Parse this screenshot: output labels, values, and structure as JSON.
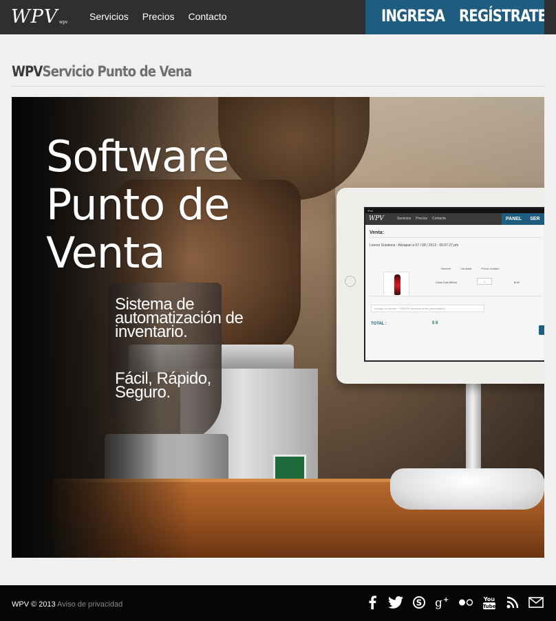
{
  "header": {
    "logo": "WPV",
    "logo_small": "wpv",
    "nav": [
      "Servicios",
      "Precios",
      "Contacto"
    ],
    "login": "INGRESA",
    "register": "REGÍSTRATE"
  },
  "page": {
    "brand": "WPV",
    "title": "Servicio Punto de Vena"
  },
  "hero": {
    "title": "Software Punto de Venta",
    "subtitle": "Sistema de automatización de inventario.",
    "tagline": "Fácil, Rápido, Seguro.",
    "screen": {
      "status": "iPad",
      "logo": "WPV",
      "nav": [
        "Servicios",
        "Precios",
        "Contacto"
      ],
      "panel": "PANEL",
      "panel_next": "SER",
      "heading": "Venta:",
      "meta": "Lemon Solutions - Atizapan a 07 / 08 / 2013 - 05:07:27 pm",
      "columns": [
        "Nombre",
        "Cantidad",
        "Precio Unitario"
      ],
      "item_name": "Coca Cola 600ml",
      "item_qty": "1",
      "item_price": "$ 00",
      "input_placeholder": "<código de barras> + ENTER presione enter para añadirlo",
      "total_label": "TOTAL :",
      "total_value": "$ 8"
    }
  },
  "footer": {
    "copyright": "WPV © 2013",
    "privacy": "Aviso de privacidad",
    "social_icons": [
      "facebook-icon",
      "twitter-icon",
      "skype-icon",
      "google-plus-icon",
      "flickr-icon",
      "youtube-icon",
      "rss-icon",
      "mail-icon"
    ]
  },
  "colors": {
    "topbar": "#2f2f2f",
    "accent": "#1f5d80",
    "footer": "#050505"
  }
}
